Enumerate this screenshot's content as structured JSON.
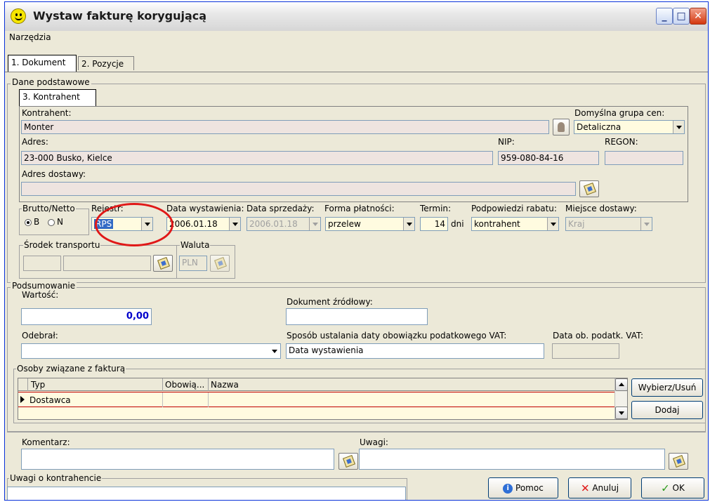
{
  "window": {
    "title": "Wystaw fakturę korygującą"
  },
  "menu": {
    "tools": "Narzędzia"
  },
  "tabs": {
    "document": "1. Dokument",
    "positions": "2. Pozycje",
    "contractor": "3. Kontrahent"
  },
  "basic": {
    "group_title": "Dane podstawowe",
    "contractor_label": "Kontrahent:",
    "contractor_value": "Monter",
    "price_group_label": "Domyślna grupa cen:",
    "price_group_value": "Detaliczna",
    "address_label": "Adres:",
    "address_value": "23-000 Busko, Kielce",
    "nip_label": "NIP:",
    "nip_value": "959-080-84-16",
    "regon_label": "REGON:",
    "regon_value": "",
    "delivery_address_label": "Adres dostawy:",
    "delivery_address_value": ""
  },
  "options": {
    "brutto_netto_label": "Brutto/Netto",
    "brutto_option": "B",
    "netto_option": "N",
    "register_label": "Rejestr:",
    "register_value": "RPS",
    "issue_date_label": "Data wystawienia:",
    "issue_date_value": "2006.01.18",
    "sale_date_label": "Data sprzedaży:",
    "sale_date_value": "2006.01.18",
    "payment_label": "Forma płatności:",
    "payment_value": "przelew",
    "term_label": "Termin:",
    "term_value": "14",
    "term_unit": "dni",
    "discount_label": "Podpowiedzi rabatu:",
    "discount_value": "kontrahent",
    "delivery_place_label": "Miejsce dostawy:",
    "delivery_place_value": "Kraj",
    "transport_label": "Środek transportu",
    "currency_label": "Waluta",
    "currency_value": "PLN"
  },
  "summary": {
    "group_title": "Podsumowanie",
    "value_label": "Wartość:",
    "value": "0,00",
    "source_doc_label": "Dokument źródłowy:",
    "source_doc_value": "",
    "received_label": "Odebrał:",
    "received_value": "",
    "vat_date_method_label": "Sposób ustalania daty obowiązku podatkowego VAT:",
    "vat_date_method_value": "Data wystawienia",
    "vat_date_label": "Data ob. podatk. VAT:",
    "vat_date_value": ""
  },
  "persons": {
    "group_title": "Osoby związane z fakturą",
    "col_type": "Typ",
    "col_required": "Obowią...",
    "col_name": "Nazwa",
    "rows": [
      {
        "type": "Dostawca",
        "required": "",
        "name": ""
      }
    ],
    "select_button": "Wybierz/Usuń",
    "add_button": "Dodaj"
  },
  "notes": {
    "comment_label": "Komentarz:",
    "remarks_label": "Uwagi:",
    "contractor_remarks_label": "Uwagi o kontrahencie"
  },
  "footer": {
    "help": "Pomoc",
    "cancel": "Anuluj",
    "ok": "OK"
  },
  "colors": {
    "ellipse": "#e01818",
    "title_border": "#0831d9",
    "value_blue": "#0000cc"
  }
}
